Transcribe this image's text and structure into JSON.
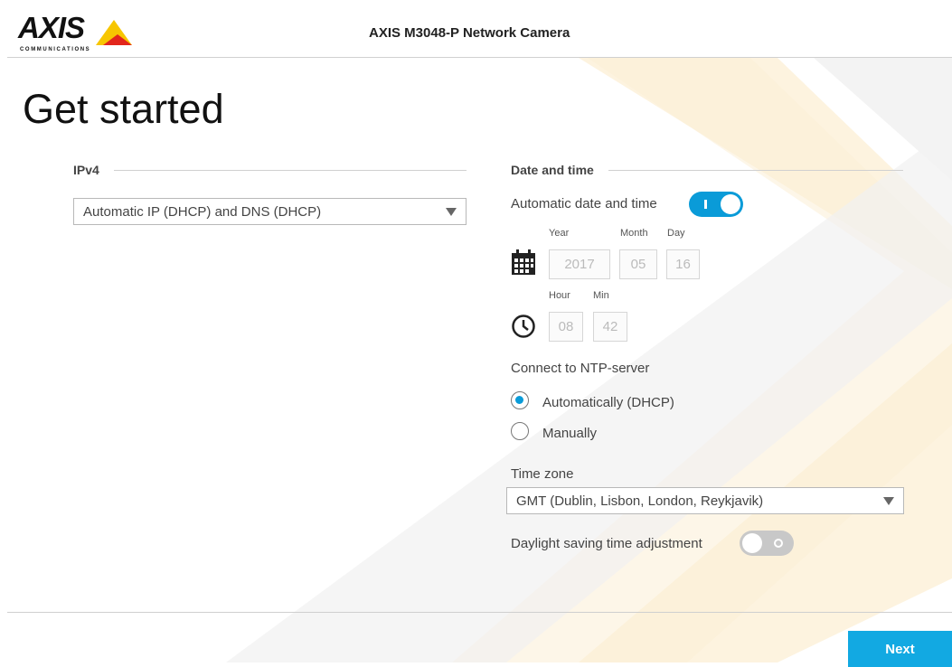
{
  "header": {
    "logo_text": "AXIS",
    "logo_subtext": "COMMUNICATIONS",
    "title": "AXIS M3048-P Network Camera"
  },
  "page": {
    "title": "Get started"
  },
  "ipv4": {
    "heading": "IPv4",
    "mode_value": "Automatic IP (DHCP) and DNS (DHCP)"
  },
  "datetime": {
    "heading": "Date and time",
    "auto_label": "Automatic date and time",
    "auto_enabled": true,
    "labels": {
      "year": "Year",
      "month": "Month",
      "day": "Day",
      "hour": "Hour",
      "min": "Min"
    },
    "values": {
      "year": "2017",
      "month": "05",
      "day": "16",
      "hour": "08",
      "min": "42"
    }
  },
  "ntp": {
    "heading": "Connect to NTP-server",
    "options": [
      {
        "label": "Automatically (DHCP)",
        "selected": true
      },
      {
        "label": "Manually",
        "selected": false
      }
    ]
  },
  "timezone": {
    "label": "Time zone",
    "value": "GMT (Dublin, Lisbon, London, Reykjavik)"
  },
  "dst": {
    "label": "Daylight saving time adjustment",
    "enabled": false
  },
  "footer": {
    "next_label": "Next"
  },
  "colors": {
    "accent": "#0a9bd8",
    "button": "#12a9e2",
    "logo_yellow": "#f7c600",
    "logo_red": "#e2261c"
  }
}
